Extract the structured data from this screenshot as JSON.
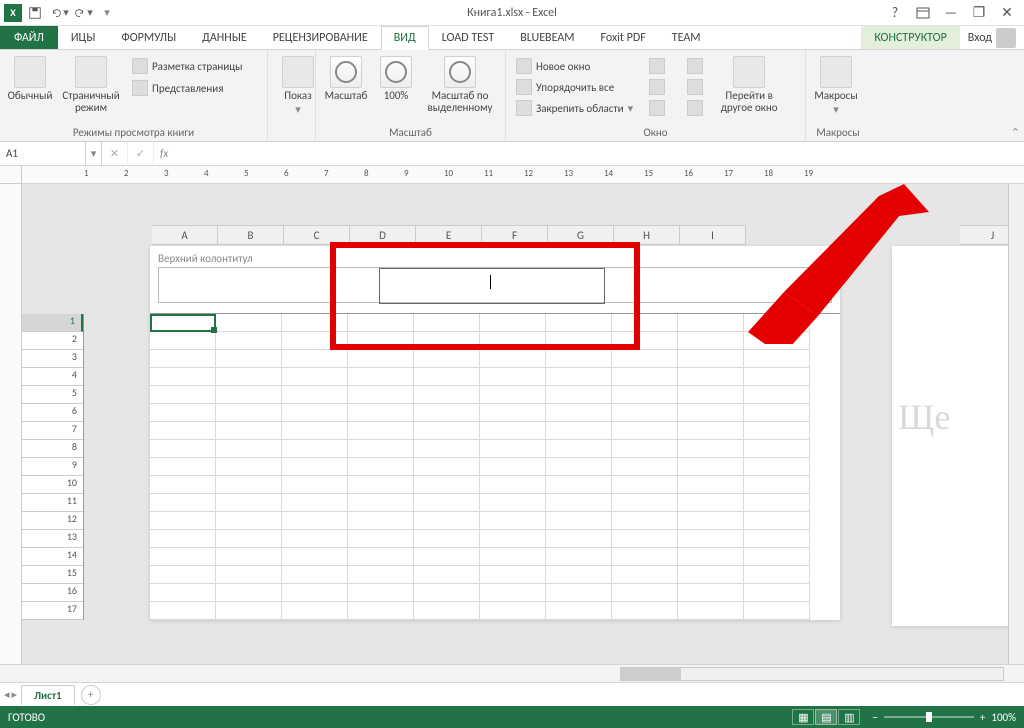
{
  "title": "Книга1.xlsx - Excel",
  "qat": {
    "save": "save-icon",
    "undo": "undo-icon",
    "redo": "redo-icon"
  },
  "win": {
    "help": "?",
    "ribbon": "",
    "min": "—",
    "max": "❐",
    "close": "✕"
  },
  "tabs": {
    "file": "ФАЙЛ",
    "items": [
      "ИЦЫ",
      "ФОРМУЛЫ",
      "ДАННЫЕ",
      "РЕЦЕНЗИРОВАНИЕ",
      "ВИД",
      "LOAD TEST",
      "BLUEBEAM",
      "Foxit PDF",
      "TEAM"
    ],
    "active_index": 4,
    "contextual": "КОНСТРУКТОР",
    "login": "Вход"
  },
  "ribbon": {
    "g1": {
      "normal": "Обычный",
      "pagebreak": "Страничный\nрежим",
      "pagelayout": "Разметка страницы",
      "custom": "Представления",
      "label": "Режимы просмотра книги"
    },
    "g2": {
      "show": "Показ",
      "label": ""
    },
    "g3": {
      "zoom": "Масштаб",
      "hundred": "100%",
      "sel": "Масштаб по\nвыделенному",
      "label": "Масштаб"
    },
    "g4": {
      "newwin": "Новое окно",
      "arrange": "Упорядочить все",
      "freeze": "Закрепить области",
      "switch": "Перейти в\nдругое окно",
      "label": "Окно"
    },
    "g5": {
      "macros": "Макросы",
      "label": "Макросы"
    }
  },
  "formula": {
    "name": "A1",
    "fx": "fx"
  },
  "ruler_marks": [
    1,
    2,
    3,
    4,
    5,
    6,
    7,
    8,
    9,
    10,
    11,
    12,
    13,
    14,
    15,
    16,
    17,
    18,
    19
  ],
  "cols": [
    "A",
    "B",
    "C",
    "D",
    "E",
    "F",
    "G",
    "H",
    "I"
  ],
  "col2": "J",
  "rows": [
    1,
    2,
    3,
    4,
    5,
    6,
    7,
    8,
    9,
    10,
    11,
    12,
    13,
    14,
    15,
    16,
    17
  ],
  "header_label": "Верхний колонтитул",
  "watermark": "Ще",
  "sheet": {
    "tab1": "Лист1",
    "add": "+"
  },
  "status": {
    "ready": "ГОТОВО",
    "zoom": "100%"
  }
}
